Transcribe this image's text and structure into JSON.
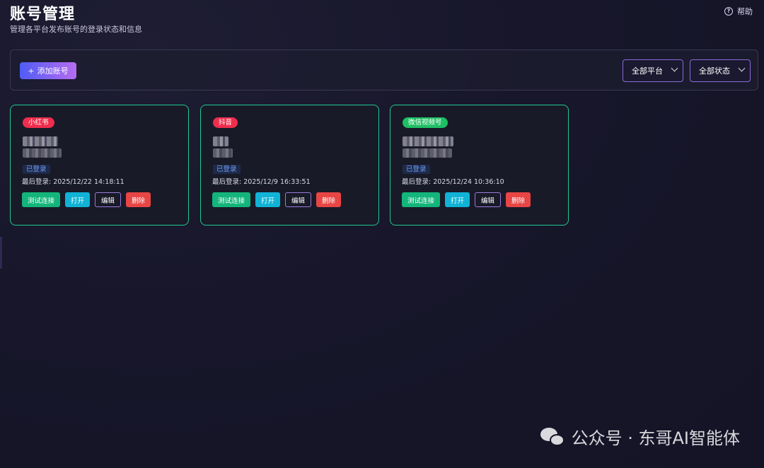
{
  "header": {
    "title": "账号管理",
    "subtitle": "管理各平台发布账号的登录状态和信息",
    "help_label": "帮助"
  },
  "toolbar": {
    "add_label": "添加账号",
    "platform_filter": "全部平台",
    "status_filter": "全部状态"
  },
  "accounts": [
    {
      "platform": "小红书",
      "platform_color": "#ef2d4c",
      "status": "已登录",
      "last_login": "最后登录: 2025/12/22 14:18:11"
    },
    {
      "platform": "抖音",
      "platform_color": "#ef2d4c",
      "status": "已登录",
      "last_login": "最后登录: 2025/12/9 16:33:51"
    },
    {
      "platform": "微信视频号",
      "platform_color": "#1fbf63",
      "status": "已登录",
      "last_login": "最后登录: 2025/12/24 10:36:10"
    }
  ],
  "actions": {
    "test": "测试连接",
    "open": "打开",
    "edit": "编辑",
    "delete": "删除"
  },
  "watermark": "公众号 · 东哥AI智能体",
  "colors": {
    "card_border": "#1fc992",
    "accent_gradient_start": "#4f5cf5",
    "accent_gradient_end": "#b56cf0"
  }
}
